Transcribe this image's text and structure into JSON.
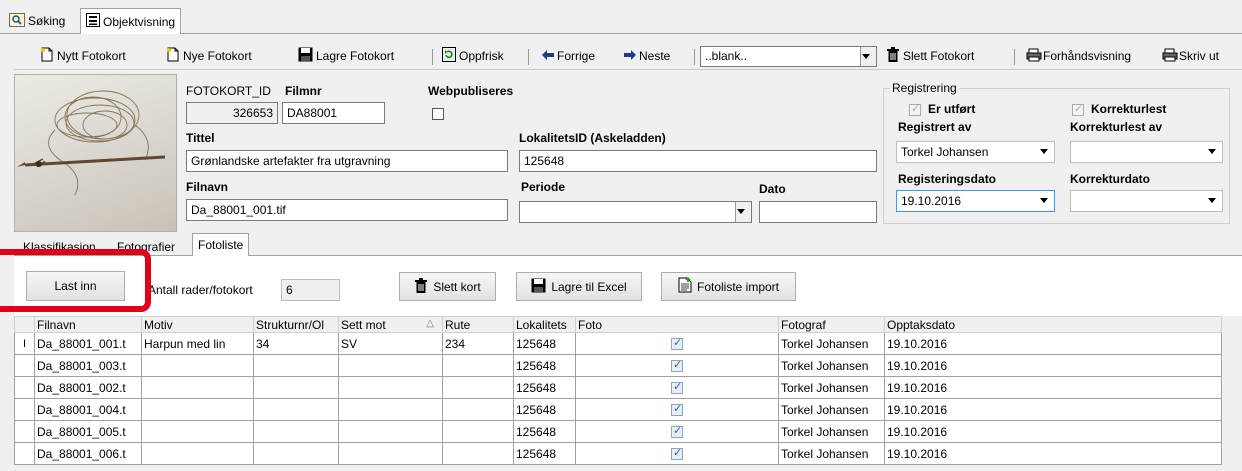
{
  "top_tabs": [
    {
      "label": "Søking",
      "icon": "search-icon"
    },
    {
      "label": "Objektvisning",
      "icon": "form-icon"
    }
  ],
  "toolbar": {
    "nytt_fotokort": "Nytt Fotokort",
    "nye_fotokort": "Nye Fotokort",
    "lagre_fotokort": "Lagre Fotokort",
    "oppfrisk": "Oppfrisk",
    "forrige": "Forrige",
    "neste": "Neste",
    "template_value": "..blank..",
    "slett_fotokort": "Slett Fotokort",
    "forhandsvisning": "Forhåndsvisning",
    "skriv_ut": "Skriv ut"
  },
  "form": {
    "fotokort_id_label": "FOTOKORT_ID",
    "fotokort_id_value": "326653",
    "filmnr_label": "Filmnr",
    "filmnr_value": "DA88001",
    "webpubliseres_label": "Webpubliseres",
    "tittel_label": "Tittel",
    "tittel_value": "Grønlandske artefakter fra utgravning",
    "lokalitet_label": "LokalitetsID (Askeladden)",
    "lokalitet_value": "125648",
    "filnavn_label": "Filnavn",
    "filnavn_value": "Da_88001_001.tif",
    "periode_label": "Periode",
    "periode_value": "",
    "dato_label": "Dato",
    "dato_value": ""
  },
  "registrering": {
    "group_label": "Registrering",
    "er_utfort_label": "Er utført",
    "korrekturlest_label": "Korrekturlest",
    "registrert_av_label": "Registrert av",
    "registrert_av_value": "Torkel Johansen",
    "korrekturlest_av_label": "Korrekturlest av",
    "korrekturlest_av_value": "",
    "registeringsdato_label": "Registeringsdato",
    "registeringsdato_value": "19.10.2016",
    "korrekturdato_label": "Korrekturdato",
    "korrekturdato_value": ""
  },
  "inner_tabs": [
    "Klassifikasjon",
    "Fotografier",
    "Fotoliste"
  ],
  "fotoliste": {
    "last_inn": "Last inn",
    "antall_label": "Antall rader/fotokort",
    "antall_value": "6",
    "slett_kort": "Slett kort",
    "lagre_excel": "Lagre til Excel",
    "fotoliste_import": "Fotoliste import"
  },
  "grid": {
    "columns": [
      "Filnavn",
      "Motiv",
      "Strukturnr/Ol",
      "Sett mot",
      "Rute",
      "Lokalitets",
      "Foto",
      "Fotograf",
      "Opptaksdato"
    ],
    "row_indicator": "I",
    "rows": [
      [
        "Da_88001_001.t",
        "Harpun med lin",
        "34",
        "SV",
        "234",
        "125648",
        "checked",
        "Torkel Johansen",
        "19.10.2016"
      ],
      [
        "Da_88001_003.t",
        "",
        "",
        "",
        "",
        "125648",
        "checked",
        "Torkel Johansen",
        "19.10.2016"
      ],
      [
        "Da_88001_002.t",
        "",
        "",
        "",
        "",
        "125648",
        "checked",
        "Torkel Johansen",
        "19.10.2016"
      ],
      [
        "Da_88001_004.t",
        "",
        "",
        "",
        "",
        "125648",
        "checked",
        "Torkel Johansen",
        "19.10.2016"
      ],
      [
        "Da_88001_005.t",
        "",
        "",
        "",
        "",
        "125648",
        "checked",
        "Torkel Johansen",
        "19.10.2016"
      ],
      [
        "Da_88001_006.t",
        "",
        "",
        "",
        "",
        "125648",
        "checked",
        "Torkel Johansen",
        "19.10.2016"
      ]
    ]
  },
  "colors": {
    "highlight_red": "#e0001b",
    "checkbox_blue": "#3b5fa0",
    "focus_blue": "#3399ff"
  }
}
